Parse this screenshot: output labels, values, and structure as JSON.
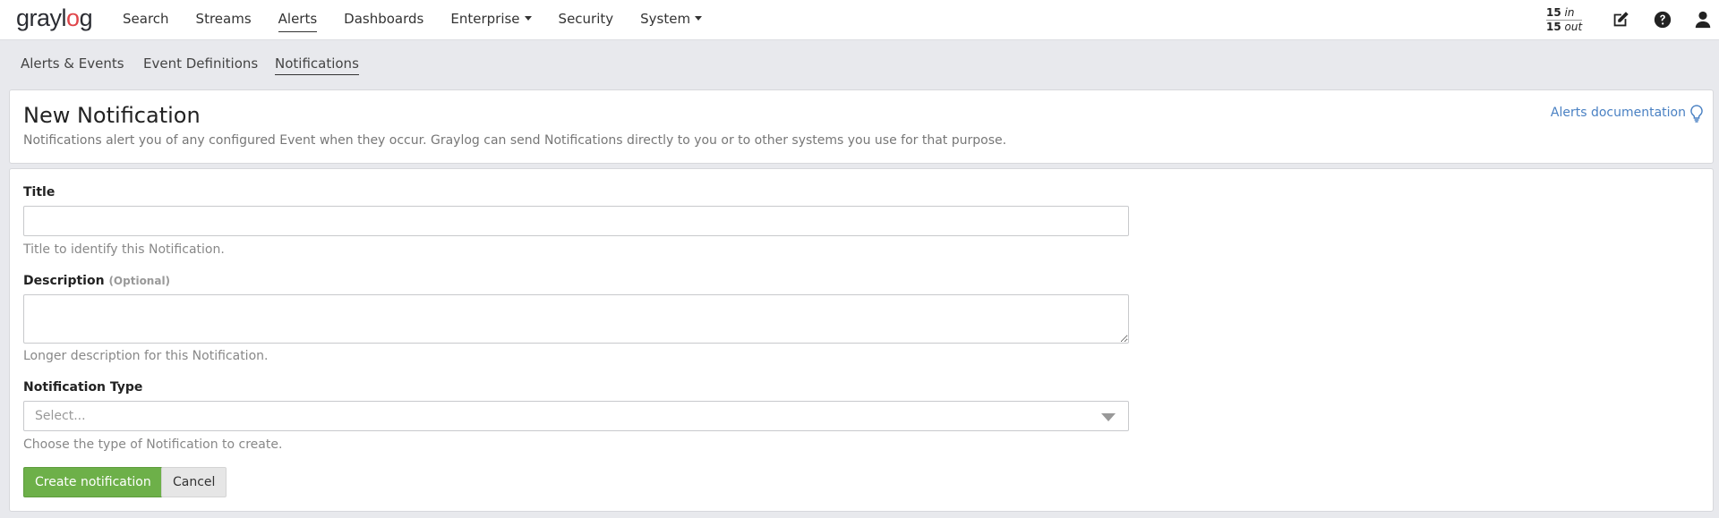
{
  "brand": {
    "logo_main": "grayl",
    "logo_accent": "o",
    "logo_end": "g"
  },
  "nav": {
    "items": [
      {
        "label": "Search"
      },
      {
        "label": "Streams"
      },
      {
        "label": "Alerts"
      },
      {
        "label": "Dashboards"
      },
      {
        "label": "Enterprise"
      },
      {
        "label": "Security"
      },
      {
        "label": "System"
      }
    ],
    "throughput": {
      "in_count": "15",
      "in_label": "in",
      "out_count": "15",
      "out_label": "out"
    },
    "icons": [
      "edit-icon",
      "help-icon",
      "user-icon"
    ]
  },
  "subnav": {
    "items": [
      {
        "label": "Alerts & Events"
      },
      {
        "label": "Event Definitions"
      },
      {
        "label": "Notifications"
      }
    ]
  },
  "header": {
    "title": "New Notification",
    "subtitle": "Notifications alert you of any configured Event when they occur. Graylog can send Notifications directly to you or to other systems you use for that purpose.",
    "doc_link": "Alerts documentation"
  },
  "form": {
    "title_label": "Title",
    "title_value": "",
    "title_help": "Title to identify this Notification.",
    "description_label": "Description",
    "description_optional": "(Optional)",
    "description_value": "",
    "description_help": "Longer description for this Notification.",
    "type_label": "Notification Type",
    "type_placeholder": "Select...",
    "type_help": "Choose the type of Notification to create.",
    "create_button": "Create notification",
    "cancel_button": "Cancel"
  },
  "colors": {
    "primary": "#6db049",
    "link": "#4a81c3",
    "logo_accent": "#e0454a"
  }
}
